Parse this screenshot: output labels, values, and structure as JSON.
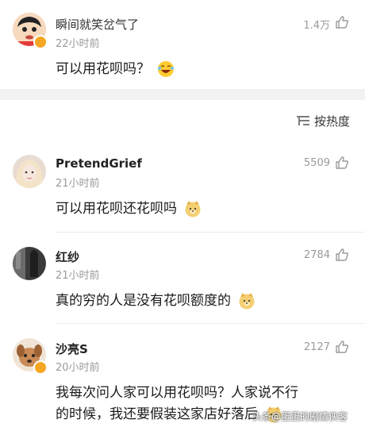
{
  "post": {
    "author": "瞬间就笑岔气了",
    "time": "22小时前",
    "likes": "1.4万",
    "text": "可以用花呗吗？"
  },
  "sort": {
    "label": "按热度"
  },
  "comments": [
    {
      "author": "PretendGrief",
      "time": "21小时前",
      "likes": "5509",
      "text": "可以用花呗还花呗吗"
    },
    {
      "author": "红纱",
      "time": "21小时前",
      "likes": "2784",
      "text": "真的穷的人是没有花呗额度的"
    },
    {
      "author": "沙亮S",
      "time": "20小时前",
      "likes": "2127",
      "text_line1": "我每次问人家可以用花呗吗？人家说不行",
      "text_line2": "的时候，我还要假装这家店好落后"
    }
  ],
  "watermark": "头条@蛋蛋的剧情侠客",
  "icons": {
    "like": "thumbs-up-icon",
    "sort": "sort-icon",
    "laugh": "laugh-emoji",
    "doge": "doge-emoji",
    "verified": "verified-badge-icon"
  }
}
